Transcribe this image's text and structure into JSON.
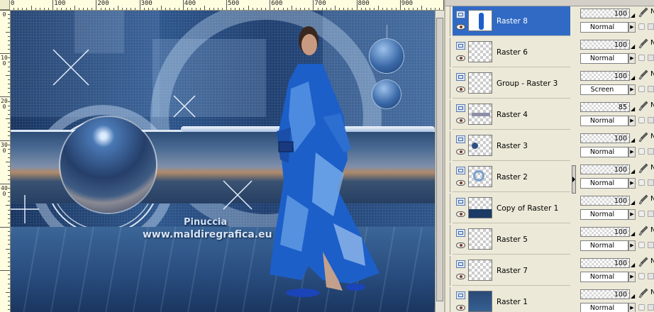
{
  "canvas": {
    "ruler_top_labels": [
      "0",
      "100",
      "200",
      "300",
      "400",
      "500",
      "600",
      "700",
      "800",
      "900"
    ],
    "ruler_left_labels": [
      "0",
      "100",
      "200",
      "300",
      "400"
    ],
    "watermark": {
      "name": "Pinuccia",
      "url": "www.maldiregrafica.eu"
    }
  },
  "layers": [
    {
      "name": "Raster 8",
      "opacity": "100",
      "blend": "Normal",
      "selected": true,
      "thumb": "figure"
    },
    {
      "name": "Raster 6",
      "opacity": "100",
      "blend": "Normal",
      "selected": false,
      "thumb": "sparkle"
    },
    {
      "name": "Group - Raster 3",
      "opacity": "100",
      "blend": "Screen",
      "selected": false,
      "thumb": "empty"
    },
    {
      "name": "Raster 4",
      "opacity": "85",
      "blend": "Normal",
      "selected": false,
      "thumb": "band"
    },
    {
      "name": "Raster 3",
      "opacity": "100",
      "blend": "Normal",
      "selected": false,
      "thumb": "orb"
    },
    {
      "name": "Raster 2",
      "opacity": "100",
      "blend": "Normal",
      "selected": false,
      "thumb": "ring"
    },
    {
      "name": "Copy of Raster 1",
      "opacity": "100",
      "blend": "Normal",
      "selected": false,
      "thumb": "strip"
    },
    {
      "name": "Raster 5",
      "opacity": "100",
      "blend": "Normal",
      "selected": false,
      "thumb": "empty"
    },
    {
      "name": "Raster 7",
      "opacity": "100",
      "blend": "Normal",
      "selected": false,
      "thumb": "empty"
    },
    {
      "name": "Raster 1",
      "opacity": "100",
      "blend": "Normal",
      "selected": false,
      "thumb": "background"
    }
  ],
  "partial_column_letter": "N",
  "colors": {
    "selection": "#316ac5",
    "panel_bg": "#ece9d8",
    "artwork_blue": "#1d3866"
  }
}
